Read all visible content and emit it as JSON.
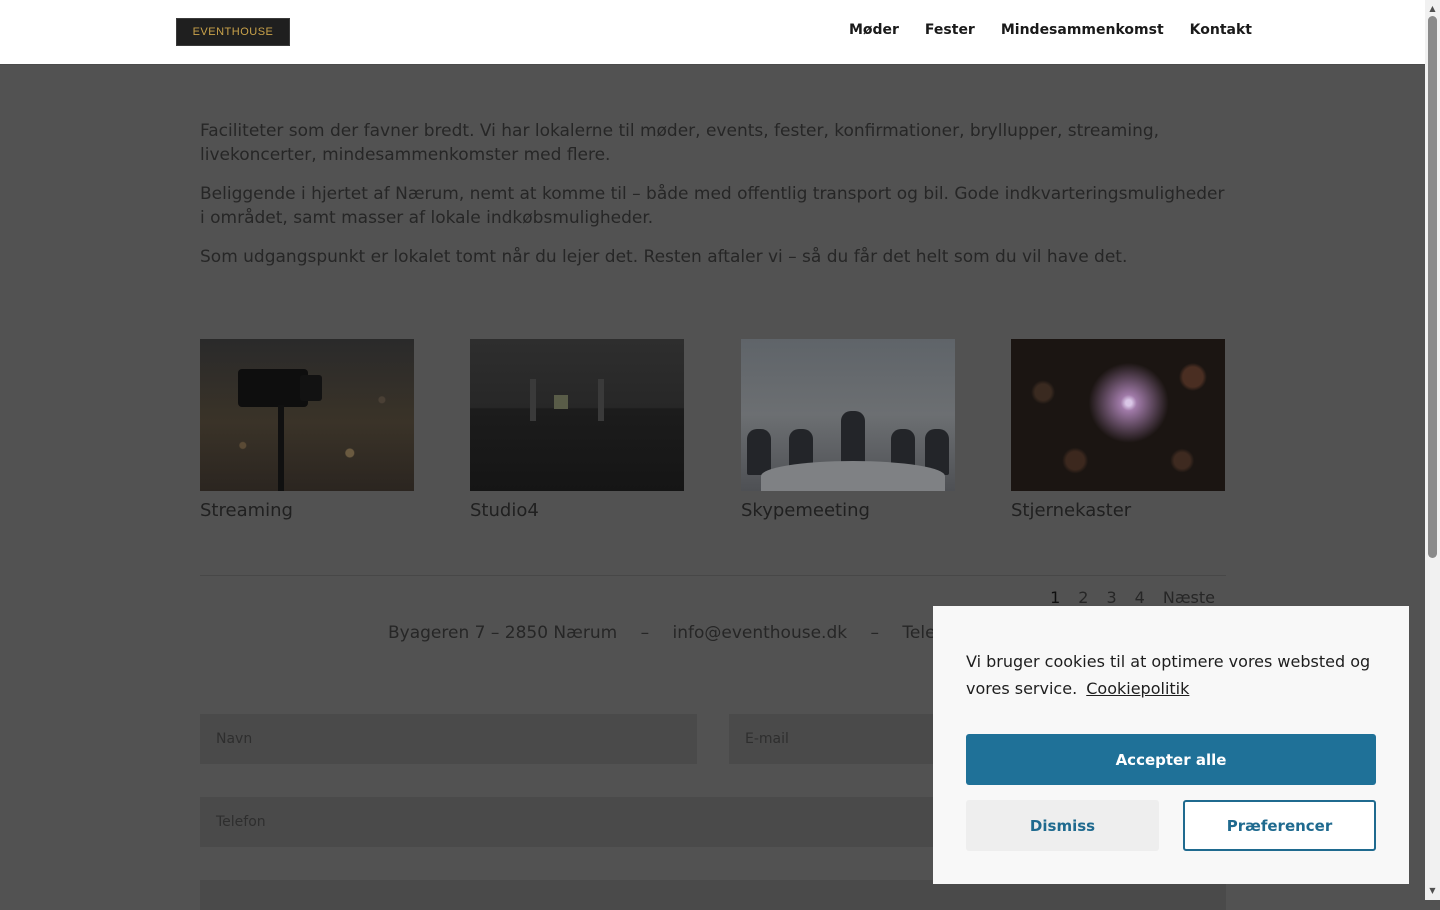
{
  "header": {
    "logo_text": "EVENTHOUSE",
    "nav": [
      {
        "label": "Møder"
      },
      {
        "label": "Fester"
      },
      {
        "label": "Mindesammenkomst"
      },
      {
        "label": "Kontakt"
      }
    ]
  },
  "intro": {
    "paragraphs": [
      "Faciliteter som der favner bredt. Vi har lokalerne til møder, events, fester, konfirmationer, bryllupper, streaming, livekoncerter, mindesammenkomster med flere.",
      "Beliggende i hjertet af Nærum, nemt at komme til – både med offentlig transport og bil. Gode indkvarteringsmuligheder i området, samt masser af lokale indkøbsmuligheder.",
      "Som udgangspunkt er lokalet tomt når du lejer det. Resten aftaler vi – så du får det helt som du vil have det."
    ]
  },
  "cards": [
    {
      "title": "Streaming"
    },
    {
      "title": "Studio4"
    },
    {
      "title": "Skypemeeting"
    },
    {
      "title": "Stjernekaster"
    }
  ],
  "pagination": {
    "pages": [
      "1",
      "2",
      "3",
      "4"
    ],
    "next": "Næste"
  },
  "footer": {
    "address": "Byageren 7 – 2850 Nærum",
    "sep": "–",
    "email": "info@eventhouse.dk",
    "phone_label": "Telefo"
  },
  "form": {
    "name_placeholder": "Navn",
    "email_placeholder": "E-mail",
    "phone_placeholder": "Telefon"
  },
  "cookie": {
    "text": "Vi bruger cookies til at optimere vores websted og vores service.",
    "link": "Cookiepolitik",
    "accept": "Accepter alle",
    "dismiss": "Dismiss",
    "preferences": "Præferencer"
  },
  "colors": {
    "accent": "#1f7198",
    "overlay": "#525252",
    "logo_gold": "#c9a24a"
  }
}
